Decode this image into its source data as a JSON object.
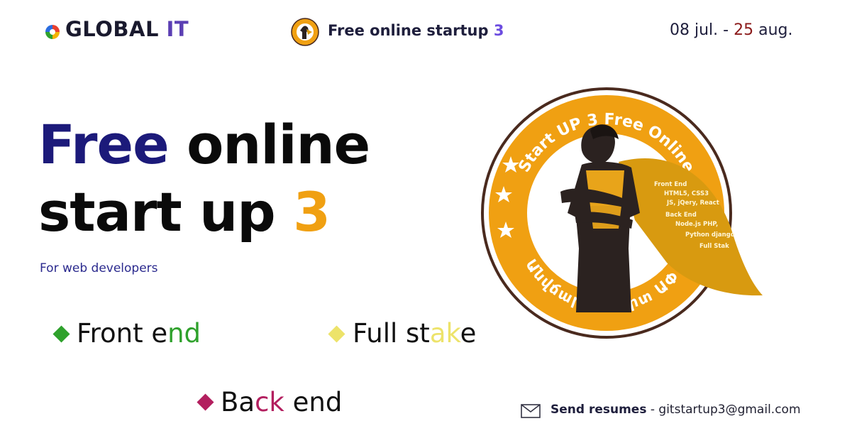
{
  "header": {
    "brand": {
      "part1": "GLOBAL",
      "part2": "IT"
    },
    "mini_title": {
      "text": "Free online startup",
      "number": "3"
    },
    "dates": {
      "start": "08 jul.",
      "separator": " - ",
      "end_day": "25",
      "end_month": " aug."
    }
  },
  "headline": {
    "line1_accent": "Free",
    "line1_rest": " online",
    "line2_text": "start up ",
    "line2_number": "3"
  },
  "subtitle": "For web developers",
  "tracks": [
    {
      "pre": "Front e",
      "hl": "nd",
      "post": "",
      "color": "#2fa12c"
    },
    {
      "pre": "Full st",
      "hl": "ak",
      "post": "e",
      "color": "#ede36a"
    },
    {
      "pre": "Ba",
      "hl": "ck",
      "post": " end",
      "color": "#b31f5f"
    }
  ],
  "contact": {
    "label": "Send resumes",
    "separator": " - ",
    "email": "gitstartup3@gmail.com"
  },
  "seal": {
    "top_text": "Start UP 3 Free Online",
    "bottom_text": "Անվճար Ստարտ ԱՓ 3",
    "cape_text": [
      "Front End",
      "HTML5, CSS3",
      "JS, jQery, React",
      "Back End",
      "Node.js PHP,",
      "Python django",
      "Full Stak"
    ]
  },
  "colors": {
    "brand_accent": "#5b3fb3",
    "headline_navy": "#1c1a7a",
    "headline_gold": "#f0a012",
    "seal_orange": "#f0a012",
    "seal_ring": "#4a2a1e"
  }
}
